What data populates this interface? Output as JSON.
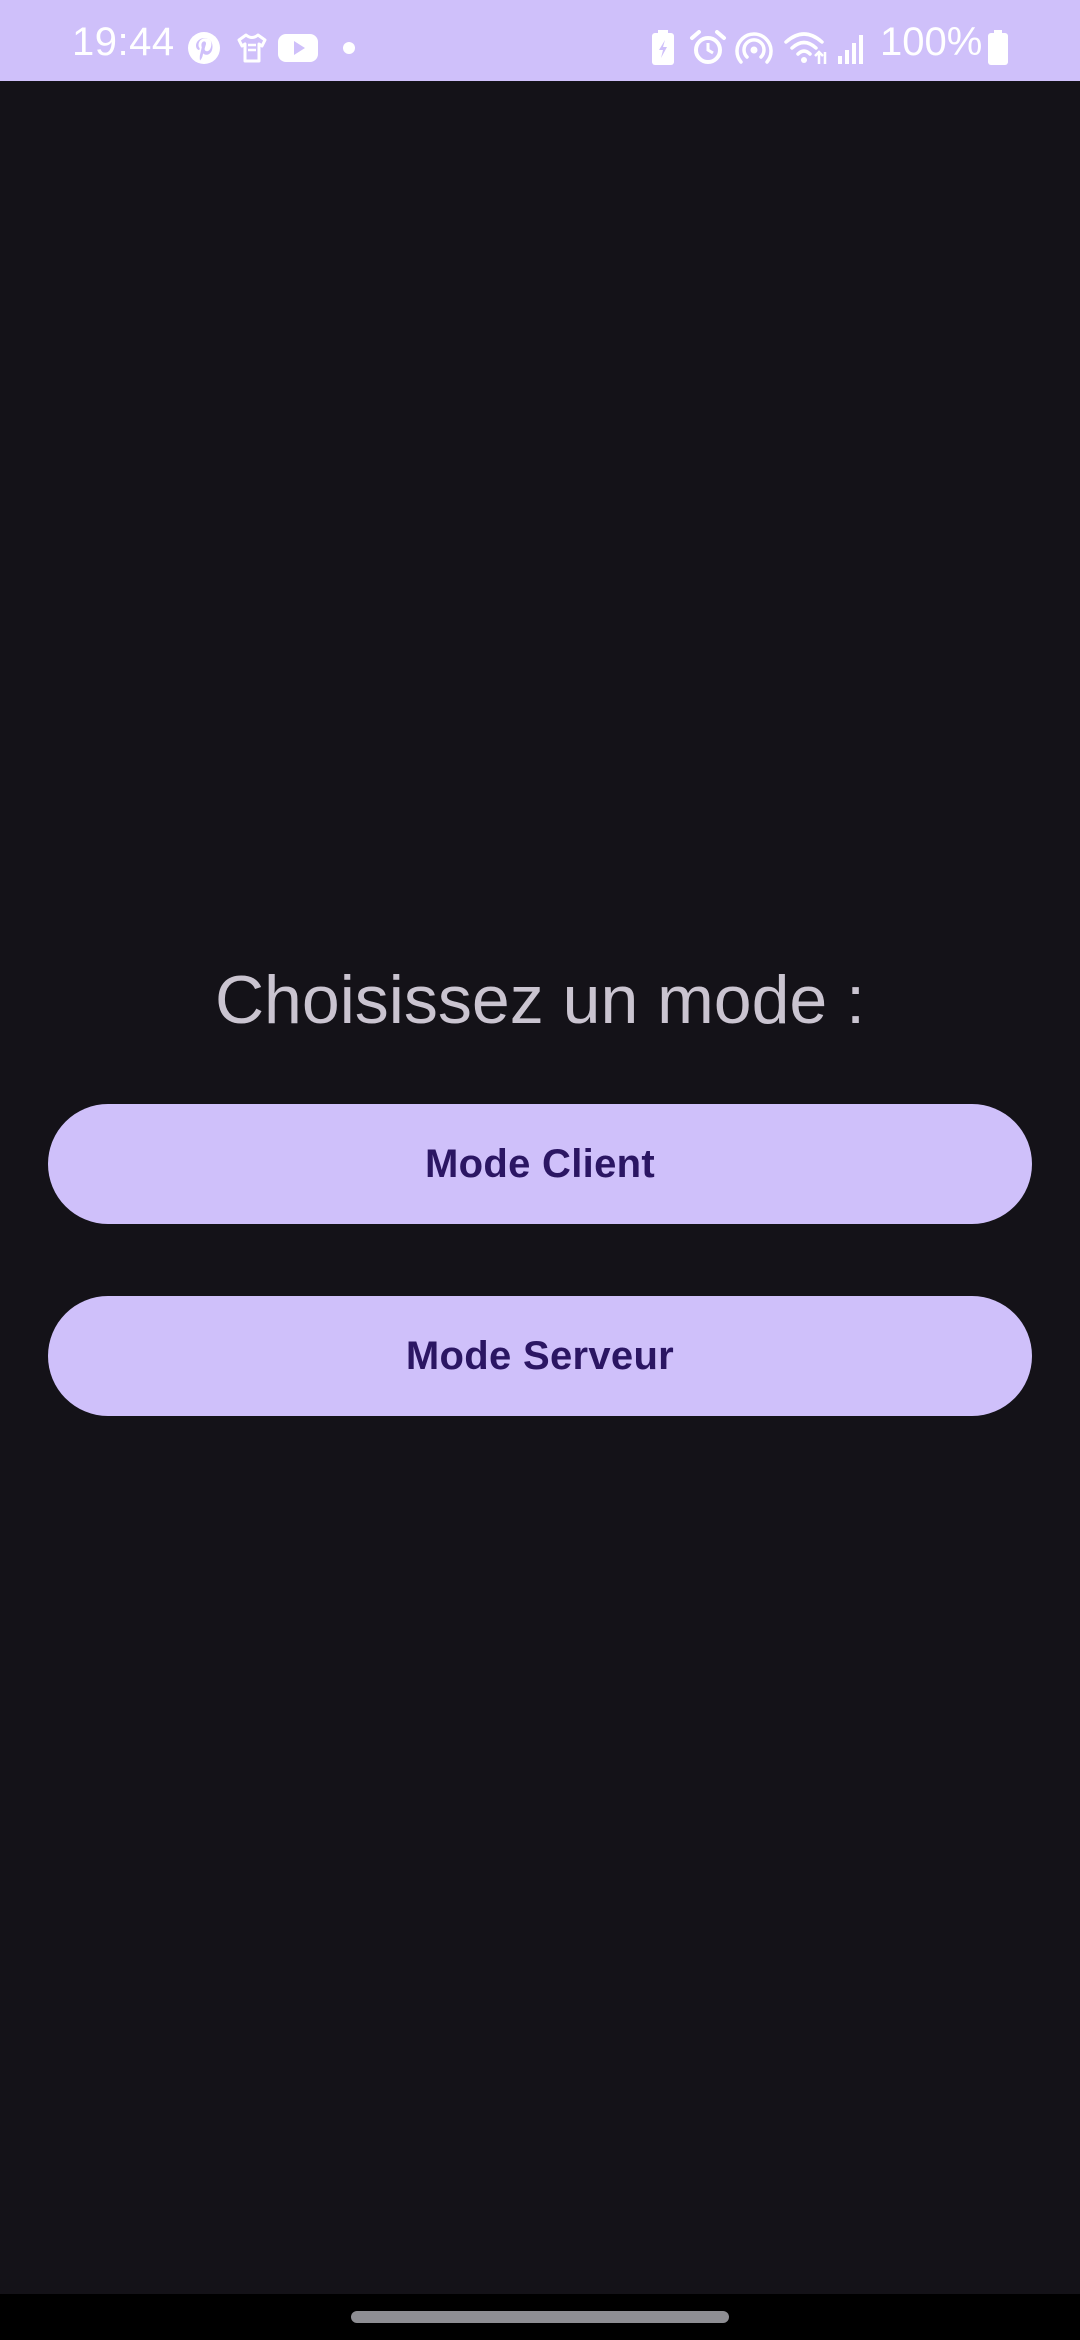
{
  "status_bar": {
    "time": "19:44",
    "battery_text": "100%",
    "left_icons": [
      "pinterest-icon",
      "shirt-icon",
      "youtube-icon",
      "notification-dot-icon"
    ],
    "right_icons": [
      "battery-saver-icon",
      "alarm-icon",
      "hotspot-icon",
      "wifi-icon",
      "signal-icon",
      "battery-icon"
    ],
    "background_color": "#CFC0FA"
  },
  "main": {
    "title": "Choisissez un mode :",
    "buttons": {
      "client_label": "Mode Client",
      "server_label": "Mode Serveur"
    },
    "background_color": "#141218",
    "button_color": "#CFC0FA",
    "button_text_color": "#2B1663",
    "title_color": "#CAC4D0"
  }
}
